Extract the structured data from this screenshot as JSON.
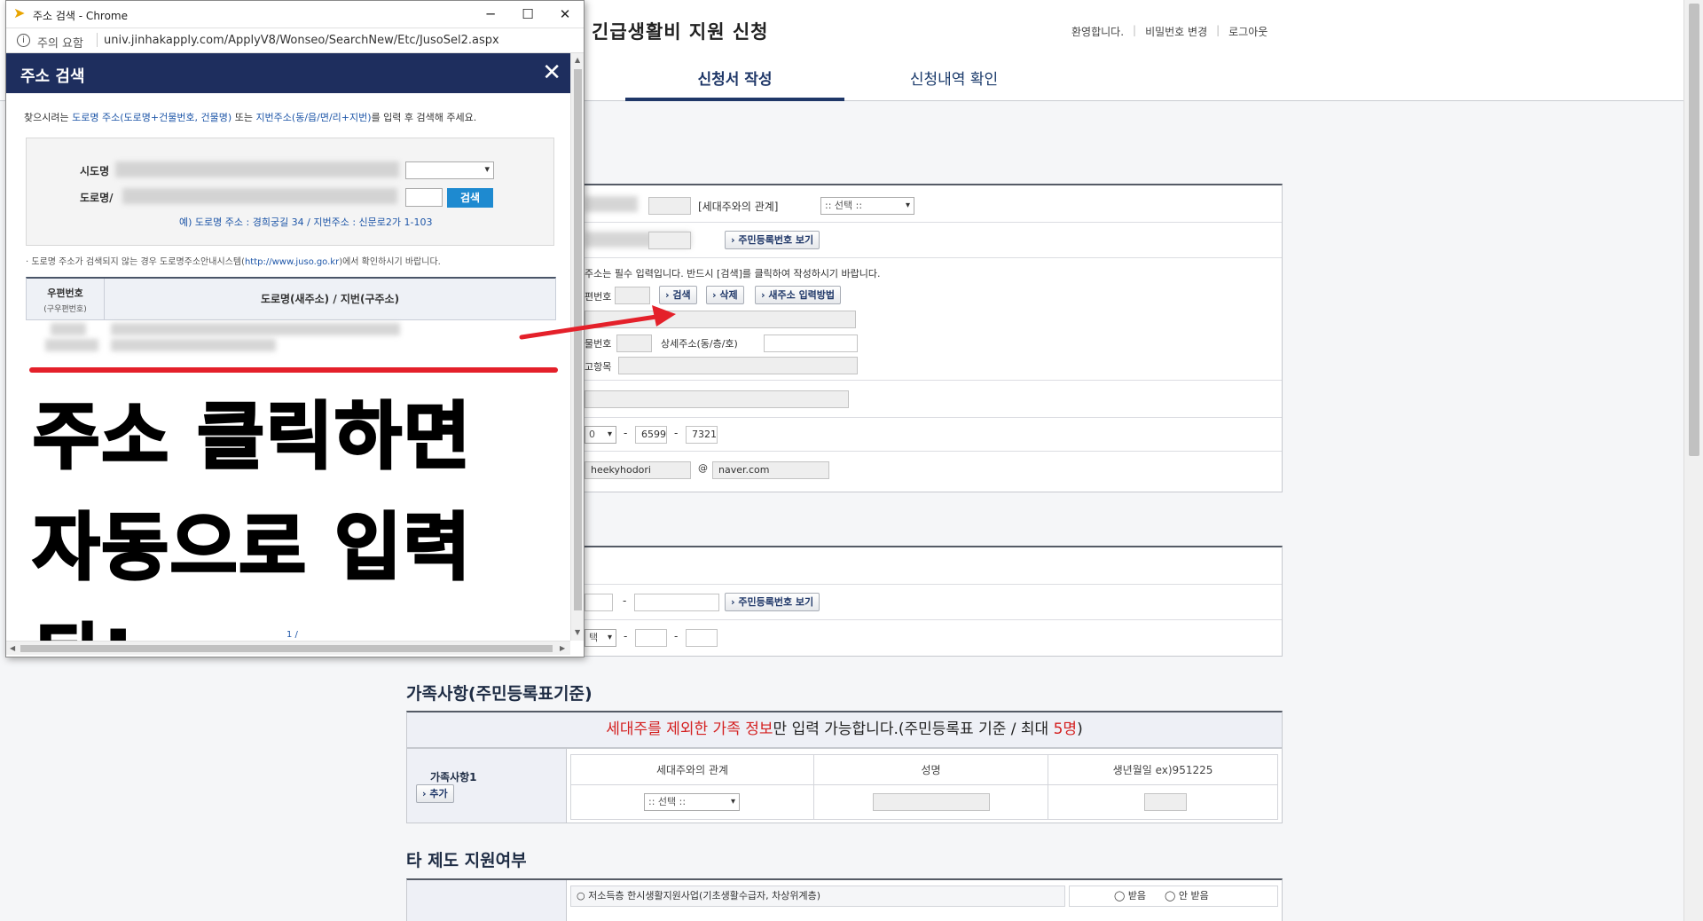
{
  "page": {
    "title": "긴급생활비 지원 신청",
    "top_links": [
      "환영합니다.",
      "비밀번호 변경",
      "로그아웃"
    ],
    "tabs": [
      "신청서 작성",
      "신청내역 확인"
    ],
    "applicant": {
      "relation_label": "[세대주와의 관계]",
      "relation_select": ":: 선택 ::",
      "rrn_button": "주민등록번호 보기",
      "address_notice": "주소는 필수 입력입니다. 반드시 [검색]를 클릭하여 작성하시기 바랍니다.",
      "zip_label": "편번호",
      "search_btn": "검색",
      "delete_btn": "삭제",
      "new_address_btn": "새주소 입력방법",
      "building_label": "물번호",
      "detail_label": "상세주소(동/층/호)",
      "ref_label": "고항목",
      "phone_prefix": "0",
      "phone_mid": "6599",
      "phone_last": "7321",
      "email_id": "heekyhodori",
      "email_at": "@",
      "email_domain": "naver.com"
    },
    "second_table": {
      "rrn_button": "주민등록번호 보기",
      "phone_select": "택"
    },
    "family": {
      "section_title": "가족사항(주민등록표기준)",
      "notice_red": "세대주를 제외한 가족 정보",
      "notice_rest": "만 입력 가능합니다.(주민등록표 기준 / 최대 ",
      "notice_count": "5명",
      "notice_close": ")",
      "item_label": "가족사항1",
      "add_btn": "추가",
      "col_relation": "세대주와의 관계",
      "col_name": "성명",
      "col_birth": "생년월일 ex)951225",
      "relation_select": ":: 선택 ::"
    },
    "other": {
      "section_title": "타 제도 지원여부",
      "item": "저소득층 한시생활지원사업(기초생활수급자, 차상위계층)",
      "opt_yes": "받음",
      "opt_no": "안 받음"
    }
  },
  "popup": {
    "window_title": "주소 검색 - Chrome",
    "security": "주의 요함",
    "url": "univ.jinhakapply.com/ApplyV8/Wonseo/SearchNew/Etc/JusoSel2.aspx",
    "header_title": "주소 검색",
    "guide_pre": "찾으시려는 ",
    "guide_hl1": "도로명 주소(도로명+건물번호, 건물명)",
    "guide_mid": " 또는 ",
    "guide_hl2": "지번주소(동/읍/면/리+지번)",
    "guide_post": "를 입력 후 검색해 주세요.",
    "label_sido": "시도명",
    "label_road": "도로명/",
    "search_btn": "검색",
    "example": "예) 도로명 주소 : 경희궁길 34 / 지번주소 : 신문로2가 1-103",
    "note_pre": "· 도로명 주소가 검색되지 않는 경우 도로명주소안내시스템(",
    "note_link": "http://www.juso.go.kr",
    "note_post": ")에서 확인하시기 바랍니다.",
    "th_zip": "우편번호",
    "th_zip_sub": "(구우편번호)",
    "th_addr": "도로명(새주소) / 지번(구주소)",
    "overlay_line1": "주소 클릭하면",
    "overlay_line2": "자동으로 입력 됨!",
    "page_num": "1 /"
  }
}
